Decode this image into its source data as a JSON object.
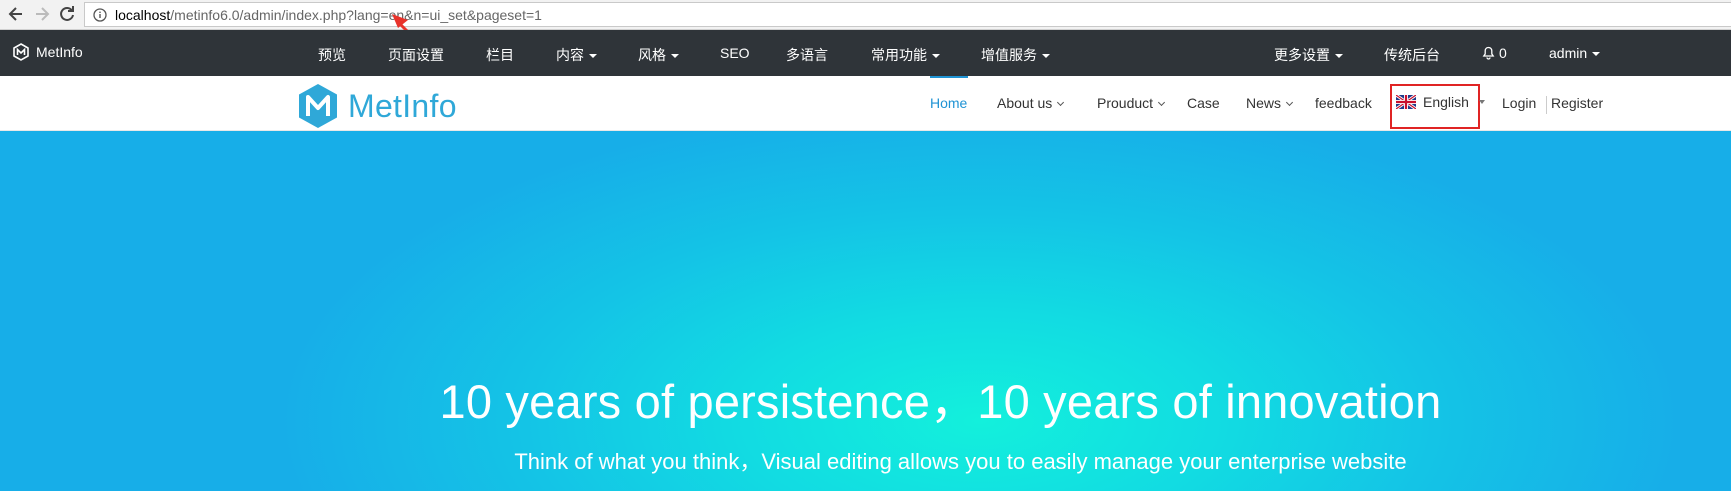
{
  "browser": {
    "url_host": "localhost",
    "url_rest": "/metinfo6.0/admin/index.php?lang=en&n=ui_set&pageset=1"
  },
  "admin_bar": {
    "brand": "MetInfo",
    "menu": [
      {
        "label": "预览",
        "dropdown": false
      },
      {
        "label": "页面设置",
        "dropdown": false
      },
      {
        "label": "栏目",
        "dropdown": false
      },
      {
        "label": "内容",
        "dropdown": true
      },
      {
        "label": "风格",
        "dropdown": true
      },
      {
        "label": "SEO",
        "dropdown": false
      },
      {
        "label": "多语言",
        "dropdown": false
      },
      {
        "label": "常用功能",
        "dropdown": true
      },
      {
        "label": "增值服务",
        "dropdown": true
      }
    ],
    "right": {
      "more_settings": "更多设置",
      "classic_backend": "传统后台",
      "notifications": "0",
      "user": "admin"
    }
  },
  "site_header": {
    "logo_text": "MetInfo",
    "nav": [
      {
        "label": "Home",
        "active": true,
        "dropdown": false
      },
      {
        "label": "About us",
        "active": false,
        "dropdown": true
      },
      {
        "label": "Prouduct",
        "active": false,
        "dropdown": true
      },
      {
        "label": "Case",
        "active": false,
        "dropdown": false
      },
      {
        "label": "News",
        "active": false,
        "dropdown": true
      },
      {
        "label": "feedback",
        "active": false,
        "dropdown": false
      }
    ],
    "language": "English",
    "login": "Login",
    "register": "Register"
  },
  "hero": {
    "title": "10 years of persistence，10 years of innovation",
    "subtitle": "Think of what you think，Visual editing allows you to easily manage your enterprise website"
  },
  "colors": {
    "accent": "#1f93d4",
    "admin_bar_bg": "#2f3439",
    "highlight_box": "#e02424",
    "hero_center": "#13f0dc",
    "hero_edge": "#17aee8"
  }
}
